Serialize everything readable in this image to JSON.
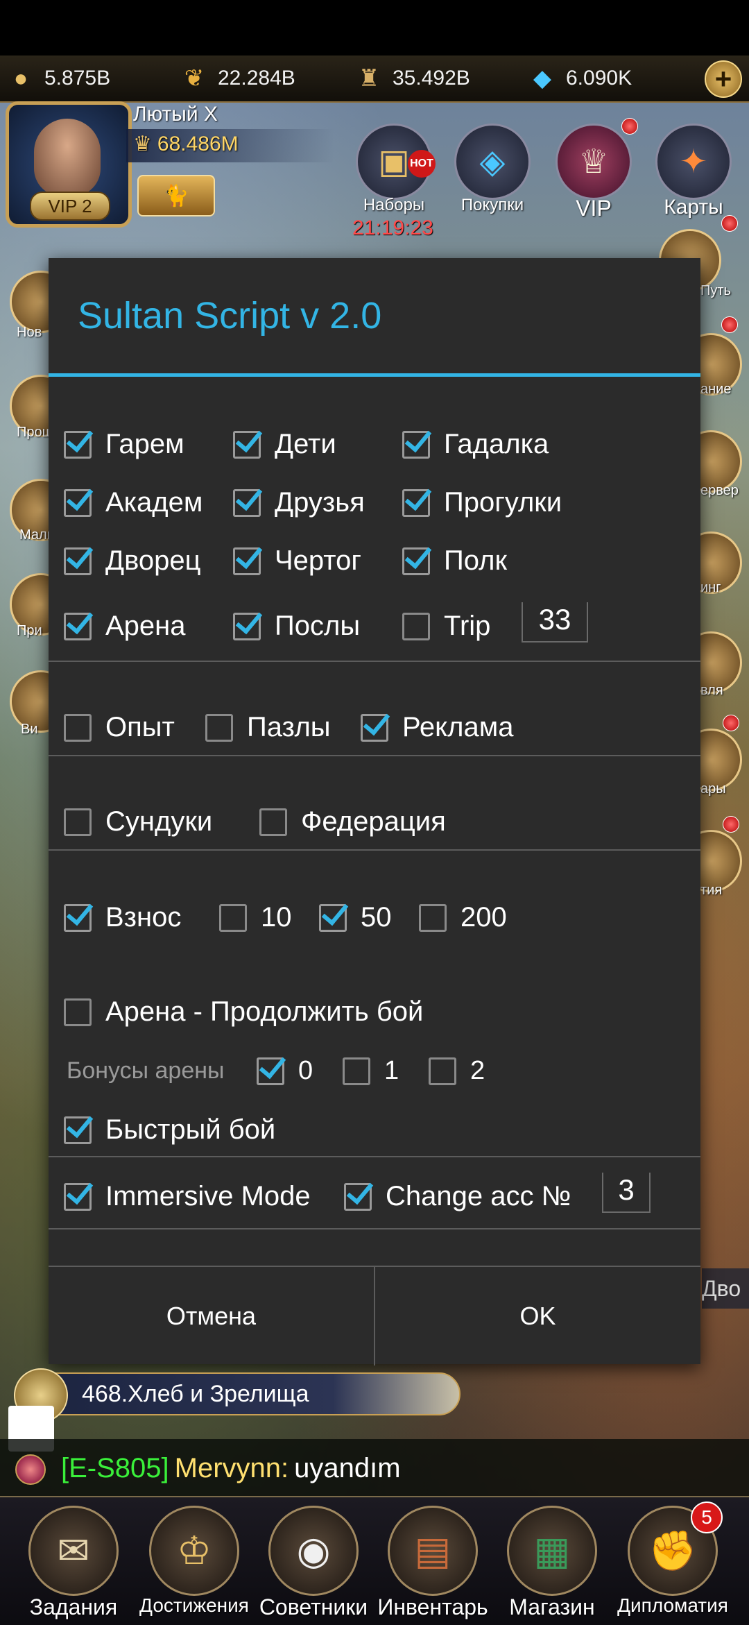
{
  "resources": {
    "coins": "5.875B",
    "food": "22.284B",
    "soldiers": "35.492B",
    "gems": "6.090K"
  },
  "player": {
    "name": "Лютый X",
    "power": "68.486M",
    "vip": "VIP 2"
  },
  "events": {
    "sets": "Наборы",
    "sets_badge": "HOT",
    "purchases": "Покупки",
    "vip": "VIP",
    "cards": "Карты",
    "timer": "21:19:23"
  },
  "dialog": {
    "title": "Sultan Script v 2.0",
    "rows": {
      "harem": {
        "label": "Гарем",
        "checked": true
      },
      "children": {
        "label": "Дети",
        "checked": true
      },
      "fortune": {
        "label": "Гадалка",
        "checked": true
      },
      "academy": {
        "label": "Академ",
        "checked": true
      },
      "friends": {
        "label": "Друзья",
        "checked": true
      },
      "walks": {
        "label": "Прогулки",
        "checked": true
      },
      "palace": {
        "label": "Дворец",
        "checked": true
      },
      "chamber": {
        "label": "Чертог",
        "checked": true
      },
      "regiment": {
        "label": "Полк",
        "checked": true
      },
      "arena": {
        "label": "Арена",
        "checked": true
      },
      "envoys": {
        "label": "Послы",
        "checked": true
      },
      "trip": {
        "label": "Trip",
        "checked": false,
        "value": "33"
      },
      "exp": {
        "label": "Опыт",
        "checked": false
      },
      "puzzles": {
        "label": "Пазлы",
        "checked": false
      },
      "ads": {
        "label": "Реклама",
        "checked": true
      },
      "chests": {
        "label": "Сундуки",
        "checked": false
      },
      "federation": {
        "label": "Федерация",
        "checked": false
      },
      "contribution": {
        "label": "Взнос",
        "checked": true
      },
      "c10": {
        "label": "10",
        "checked": false
      },
      "c50": {
        "label": "50",
        "checked": true
      },
      "c200": {
        "label": "200",
        "checked": false
      },
      "arena_continue": {
        "label": "Арена - Продолжить бой",
        "checked": false
      },
      "arena_bonus_label": "Бонусы арены",
      "b0": {
        "label": "0",
        "checked": true
      },
      "b1": {
        "label": "1",
        "checked": false
      },
      "b2": {
        "label": "2",
        "checked": false
      },
      "quick_battle": {
        "label": "Быстрый бой",
        "checked": true
      },
      "immersive": {
        "label": "Immersive Mode",
        "checked": true
      },
      "change_acc": {
        "label": "Change acc №",
        "checked": true,
        "value": "3"
      }
    },
    "cancel": "Отмена",
    "ok": "OK"
  },
  "quest": "468.Хлеб и Зрелища",
  "side_tab": "Дво",
  "chat": {
    "tag": "[E-S805]",
    "user": "Mervynn:",
    "message": "uyandım"
  },
  "nav": {
    "tasks": "Задания",
    "achievements": "Достижения",
    "advisors": "Советники",
    "inventory": "Инвентарь",
    "shop": "Магазин",
    "diplomacy": "Дипломатия",
    "diplomacy_badge": "5"
  },
  "side_labels": [
    "Нов",
    "Прощ",
    "Малы",
    "При",
    "Ви",
    "Путь",
    "ание",
    "ервер",
    "инг",
    "вля",
    "ары",
    "тия"
  ],
  "colors": {
    "accent": "#33b5e5",
    "dialog_bg": "#2b2b2b",
    "timer": "#ff4a4a"
  }
}
